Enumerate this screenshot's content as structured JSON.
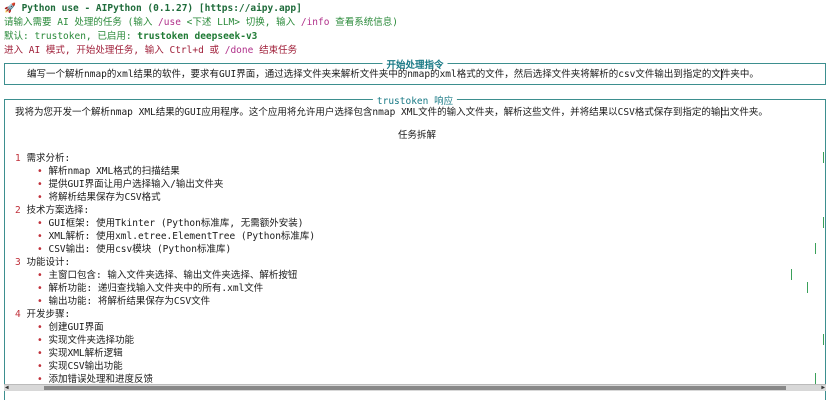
{
  "header": {
    "rocket_icon": "rocket-icon",
    "app_title": "Python use - AIPython (0.1.27) ",
    "url": "[https://aipy.app]",
    "line2_a": "请输入需要 AI 处理的任务 (输入 ",
    "line2_use": "/use",
    "line2_b": " <下述 LLM> 切换, 输入 ",
    "line2_info": "/info",
    "line2_c": " 查看系统信息)",
    "line3_a": "默认: trustoken, 已启用: ",
    "line3_b": "trustoken deepseek-v3",
    "line4_a": "进入 AI 模式, 开始处理任务, 输入 Ctrl+d 或 ",
    "line4_done": "/done",
    "line4_b": " 结束任务"
  },
  "instruction_box": {
    "title": "开始处理指令",
    "text": "编写一个解析nmap的xml结果的软件，要求有GUI界面，通过选择文件夹来解析文件夹中的nmap的xml格式的文件，然后选择文件夹将解析的csv文件输出到指定的文件夹中。"
  },
  "response_box": {
    "title": "trustoken 响应",
    "intro": "我将为您开发一个解析nmap XML结果的GUI应用程序。这个应用将允许用户选择包含nmap XML文件的输入文件夹，解析这些文件，并将结果以CSV格式保存到指定的输出文件夹。",
    "section_heading": "任务拆解",
    "sections": [
      {
        "num": "1",
        "label": "需求分析:",
        "items": [
          "解析nmap XML格式的扫描结果",
          "提供GUI界面让用户选择输入/输出文件夹",
          "将解析结果保存为CSV格式"
        ]
      },
      {
        "num": "2",
        "label": "技术方案选择:",
        "items": [
          "GUI框架: 使用Tkinter (Python标准库, 无需额外安装)",
          "XML解析: 使用xml.etree.ElementTree (Python标准库)",
          "CSV输出: 使用csv模块 (Python标准库)"
        ]
      },
      {
        "num": "3",
        "label": "功能设计:",
        "items": [
          "主窗口包含: 输入文件夹选择、输出文件夹选择、解析按钮",
          "解析功能: 递归查找输入文件夹中的所有.xml文件",
          "输出功能: 将解析结果保存为CSV文件"
        ]
      },
      {
        "num": "4",
        "label": "开发步骤:",
        "items": [
          "创建GUI界面",
          "实现文件夹选择功能",
          "实现XML解析逻辑",
          "实现CSV输出功能",
          "添加错误处理和进度反馈"
        ]
      }
    ],
    "bullet": "•"
  }
}
